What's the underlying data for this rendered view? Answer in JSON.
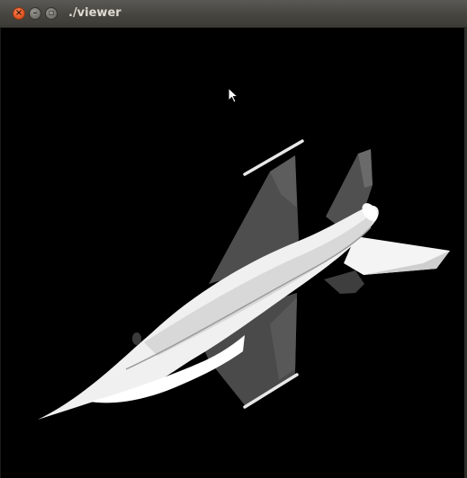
{
  "window": {
    "title": "./viewer",
    "buttons": {
      "close_icon": "close-icon",
      "minimize_icon": "minimize-icon",
      "maximize_icon": "maximize-icon"
    }
  },
  "viewport": {
    "background_color": "#000000",
    "model_color": "#ffffff",
    "shade_color": "#5c5c5c"
  },
  "cursor": {
    "icon": "arrow-cursor-icon"
  }
}
